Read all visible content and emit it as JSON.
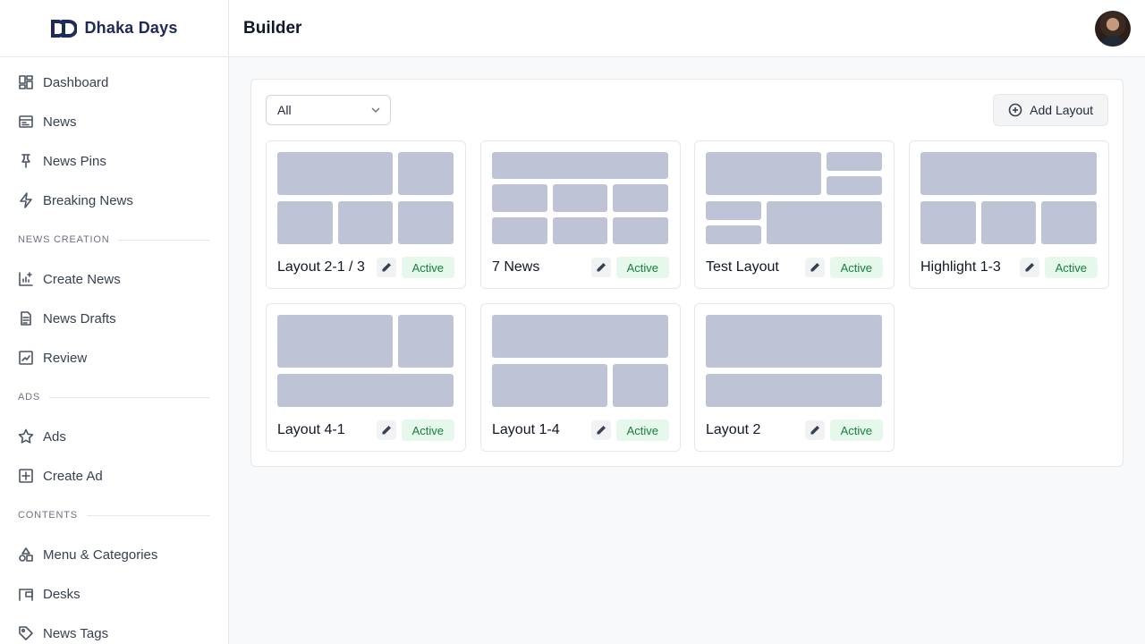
{
  "brand": {
    "name": "Dhaka Days",
    "logo_icon": "dd-logo-icon",
    "color": "#1e2a5a"
  },
  "sidebar": {
    "items": [
      {
        "label": "Dashboard",
        "icon": "dashboard-icon"
      },
      {
        "label": "News",
        "icon": "newspaper-icon"
      },
      {
        "label": "News Pins",
        "icon": "pin-icon"
      },
      {
        "label": "Breaking News",
        "icon": "lightning-icon"
      }
    ],
    "sections": [
      {
        "title": "NEWS CREATION",
        "items": [
          {
            "label": "Create News",
            "icon": "chart-plus-icon"
          },
          {
            "label": "News Drafts",
            "icon": "document-icon"
          },
          {
            "label": "Review",
            "icon": "review-icon"
          }
        ]
      },
      {
        "title": "ADS",
        "items": [
          {
            "label": "Ads",
            "icon": "star-icon"
          },
          {
            "label": "Create Ad",
            "icon": "plus-square-icon"
          }
        ]
      },
      {
        "title": "CONTENTS",
        "items": [
          {
            "label": "Menu & Categories",
            "icon": "shapes-icon"
          },
          {
            "label": "Desks",
            "icon": "desk-icon"
          },
          {
            "label": "News Tags",
            "icon": "tag-icon"
          }
        ]
      }
    ]
  },
  "header": {
    "title": "Builder",
    "avatar": "user-avatar"
  },
  "toolbar": {
    "filter_value": "All",
    "add_label": "Add Layout"
  },
  "layouts": [
    {
      "title": "Layout 2-1 / 3",
      "status": "Active"
    },
    {
      "title": "7 News",
      "status": "Active"
    },
    {
      "title": "Test Layout",
      "status": "Active"
    },
    {
      "title": "Highlight 1-3",
      "status": "Active"
    },
    {
      "title": "Layout 4-1",
      "status": "Active"
    },
    {
      "title": "Layout 1-4",
      "status": "Active"
    },
    {
      "title": "Layout 2",
      "status": "Active"
    }
  ],
  "colors": {
    "block": "#bfc3d6",
    "badge_bg": "#e6f7ec",
    "badge_text": "#15803d"
  }
}
